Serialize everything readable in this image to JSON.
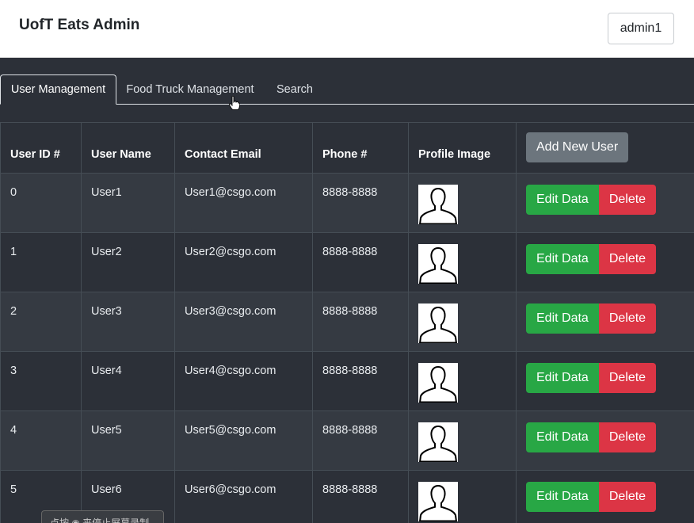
{
  "app": {
    "title": "UofT Eats Admin",
    "user_label": "admin1"
  },
  "tabs": [
    {
      "label": "User Management",
      "active": true
    },
    {
      "label": "Food Truck Management",
      "active": false
    },
    {
      "label": "Search",
      "active": false
    }
  ],
  "table": {
    "headers": [
      "User ID #",
      "User Name",
      "Contact Email",
      "Phone #",
      "Profile Image"
    ],
    "add_label": "Add New User",
    "edit_label": "Edit Data",
    "delete_label": "Delete",
    "rows": [
      {
        "id": "0",
        "name": "User1",
        "email": "User1@csgo.com",
        "phone": "8888-8888"
      },
      {
        "id": "1",
        "name": "User2",
        "email": "User2@csgo.com",
        "phone": "8888-8888"
      },
      {
        "id": "2",
        "name": "User3",
        "email": "User3@csgo.com",
        "phone": "8888-8888"
      },
      {
        "id": "3",
        "name": "User4",
        "email": "User4@csgo.com",
        "phone": "8888-8888"
      },
      {
        "id": "4",
        "name": "User5",
        "email": "User5@csgo.com",
        "phone": "8888-8888"
      },
      {
        "id": "5",
        "name": "User6",
        "email": "User6@csgo.com",
        "phone": "8888-8888"
      }
    ]
  },
  "overlay": {
    "recorder_text": "点按 ◉ 来停止屏幕录制"
  },
  "colors": {
    "edit": "#28a745",
    "delete": "#dc3545",
    "add": "#6c757d",
    "background": "#2c3038"
  },
  "icons": {
    "profile": "person-silhouette-icon",
    "pointer": "hand-pointer-icon"
  }
}
